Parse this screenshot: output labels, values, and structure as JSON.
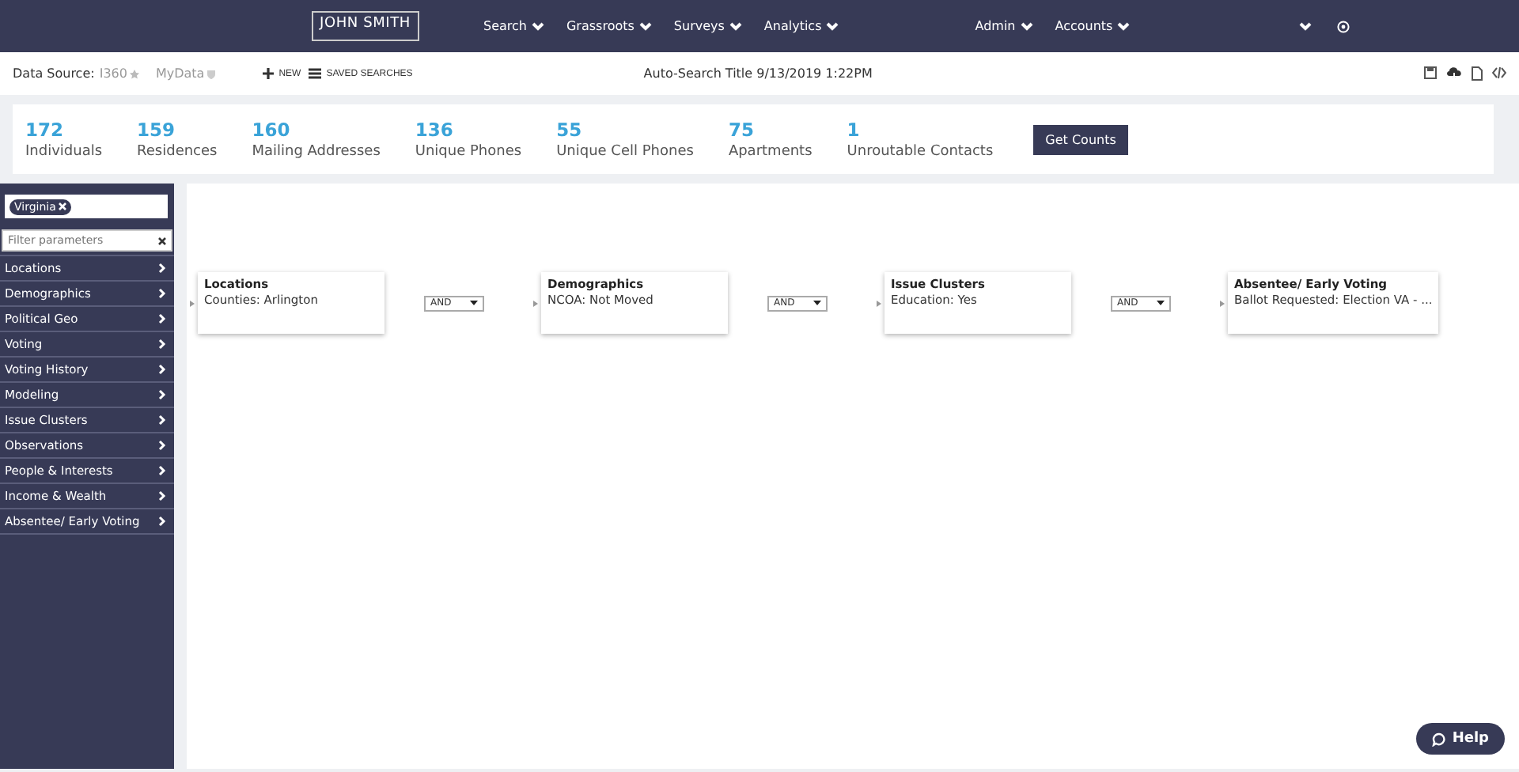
{
  "nav": {
    "logo": "JOHN SMITH",
    "menus_left": [
      "Search",
      "Grassroots",
      "Surveys",
      "Analytics"
    ],
    "menus_right": [
      "Admin",
      "Accounts"
    ]
  },
  "toolbar": {
    "data_source_label": "Data Source:",
    "sources": [
      "I360",
      "MyData"
    ],
    "actions": [
      "NEW",
      "SAVED SEARCHES"
    ],
    "search_title": "Auto-Search Title 9/13/2019 1:22PM"
  },
  "counts": [
    {
      "value": "172",
      "label": "Individuals"
    },
    {
      "value": "159",
      "label": "Residences"
    },
    {
      "value": "160",
      "label": "Mailing Addresses"
    },
    {
      "value": "136",
      "label": "Unique Phones"
    },
    {
      "value": "55",
      "label": "Unique Cell Phones"
    },
    {
      "value": "75",
      "label": "Apartments"
    },
    {
      "value": "1",
      "label": "Unroutable Contacts"
    }
  ],
  "get_counts_button": "Get Counts",
  "sidebar": {
    "tag": "Virginia",
    "filter_placeholder": "Filter parameters",
    "categories": [
      "Locations",
      "Demographics",
      "Political Geo",
      "Voting",
      "Voting History",
      "Modeling",
      "Issue Clusters",
      "Observations",
      "People & Interests",
      "Income & Wealth",
      "Absentee/ Early Voting"
    ]
  },
  "flow": {
    "nodes": [
      {
        "title": "Locations",
        "detail": "Counties: Arlington"
      },
      {
        "title": "Demographics",
        "detail": "NCOA: Not Moved"
      },
      {
        "title": "Issue Clusters",
        "detail": "Education: Yes"
      },
      {
        "title": "Absentee/ Early Voting",
        "detail": "Ballot Requested: Election VA - ..."
      }
    ],
    "operators": [
      "AND",
      "AND",
      "AND"
    ]
  },
  "help_button": "Help"
}
